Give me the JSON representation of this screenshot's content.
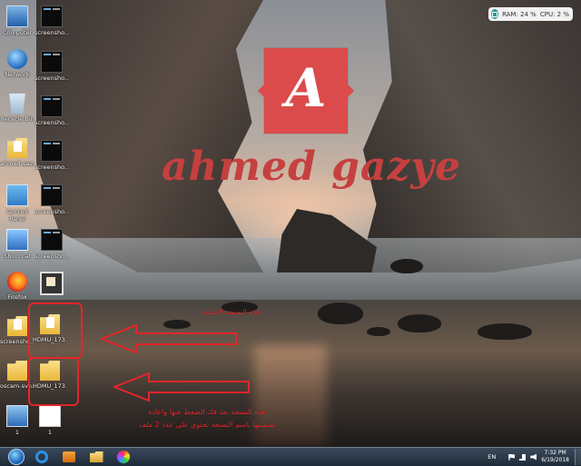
{
  "desktop": {
    "icons": [
      {
        "name": "computer",
        "label": "Computer"
      },
      {
        "name": "network",
        "label": "Network"
      },
      {
        "name": "recycle-bin",
        "label": "Recycle Bin"
      },
      {
        "name": "user-folder",
        "label": "ahmed gazye"
      },
      {
        "name": "control-panel",
        "label": "Control Panel"
      },
      {
        "name": "shortcut",
        "label": "Short cat"
      },
      {
        "name": "firefox",
        "label": "Firefox"
      },
      {
        "name": "screenshots-folder",
        "label": "screensho..."
      },
      {
        "name": "oscam-folder",
        "label": "oscam-svn..."
      },
      {
        "name": "pc-small",
        "label": "1"
      }
    ],
    "icons_col2": [
      {
        "name": "screenshot-1",
        "label": "screensho..."
      },
      {
        "name": "screenshot-2",
        "label": "screensho..."
      },
      {
        "name": "screenshot-3",
        "label": "screensho..."
      },
      {
        "name": "screenshot-4",
        "label": "screensho..."
      },
      {
        "name": "screenshot-5",
        "label": "screensho..."
      },
      {
        "name": "screenshot-6",
        "label": "screensho..."
      },
      {
        "name": "film-file",
        "label": ""
      },
      {
        "name": "hdmu-folder-1",
        "label": "HDMU_173..."
      },
      {
        "name": "hdmu-folder-2",
        "label": "HDMU_173..."
      },
      {
        "name": "blank-file",
        "label": "1"
      }
    ]
  },
  "widget": {
    "ram": "RAM: 24 %",
    "cpu": "CPU: 2 %"
  },
  "wallpaper": {
    "logo_letter": "A",
    "logo_name": "ahmed gazye"
  },
  "annotations": {
    "note_top": "هذه النسخة الأصلية",
    "note_bottom_line1": "هذه النسخة بعد فك الضغط عنها واعادة",
    "note_bottom_line2": "تسميتها باسم النسخة تحتوي على عدد 2 ملف",
    "color": "#e4252a"
  },
  "taskbar": {
    "language": "EN",
    "time": "7:32 PM",
    "date": "6/19/2018"
  }
}
